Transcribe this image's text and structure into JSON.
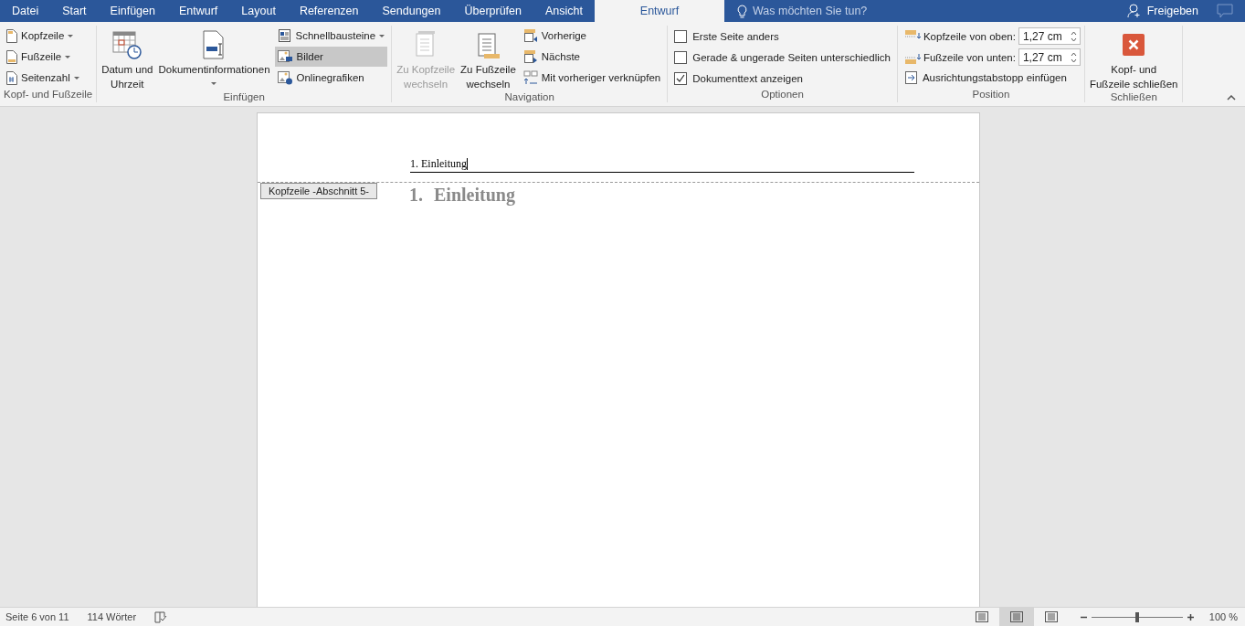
{
  "tabs": [
    {
      "label": "Datei",
      "selected": false
    },
    {
      "label": "Start",
      "selected": false
    },
    {
      "label": "Einfügen",
      "selected": false
    },
    {
      "label": "Entwurf",
      "selected": false
    },
    {
      "label": "Layout",
      "selected": false
    },
    {
      "label": "Referenzen",
      "selected": false
    },
    {
      "label": "Sendungen",
      "selected": false
    },
    {
      "label": "Überprüfen",
      "selected": false
    },
    {
      "label": "Ansicht",
      "selected": false
    },
    {
      "label": "Entwurf",
      "selected": true
    }
  ],
  "tell_me": {
    "placeholder": "Was möchten Sie tun?"
  },
  "share": {
    "label": "Freigeben"
  },
  "groups": [
    {
      "label": "Kopf- und Fußzeile",
      "columns": [
        [
          {
            "kind": "small",
            "label": "Kopfzeile",
            "dropdown": true,
            "disabled": false,
            "hovered": false
          },
          {
            "kind": "small",
            "label": "Fußzeile",
            "dropdown": true,
            "disabled": false,
            "hovered": false
          },
          {
            "kind": "small",
            "label": "Seitenzahl",
            "dropdown": true,
            "disabled": false,
            "hovered": false
          }
        ]
      ]
    },
    {
      "label": "Einfügen",
      "columns": [
        [
          {
            "kind": "large",
            "label": "Datum und\nUhrzeit",
            "dropdown": false,
            "disabled": false,
            "hovered": false
          }
        ],
        [
          {
            "kind": "large",
            "label": "Dokumentinformationen",
            "dropdown": true,
            "disabled": false,
            "hovered": false
          }
        ],
        [
          {
            "kind": "small",
            "label": "Schnellbausteine",
            "dropdown": true,
            "disabled": false,
            "hovered": false
          },
          {
            "kind": "small",
            "label": "Bilder",
            "dropdown": false,
            "disabled": false,
            "hovered": true
          },
          {
            "kind": "small",
            "label": "Onlinegrafiken",
            "dropdown": false,
            "disabled": false,
            "hovered": false
          }
        ]
      ]
    },
    {
      "label": "Navigation",
      "columns": [
        [
          {
            "kind": "large",
            "label": "Zu Kopfzeile\nwechseln",
            "dropdown": false,
            "disabled": true,
            "hovered": false
          }
        ],
        [
          {
            "kind": "large",
            "label": "Zu Fußzeile\nwechseln",
            "dropdown": false,
            "disabled": false,
            "hovered": false
          }
        ],
        [
          {
            "kind": "small",
            "label": "Vorherige",
            "dropdown": false,
            "disabled": false,
            "hovered": false
          },
          {
            "kind": "small",
            "label": "Nächste",
            "dropdown": false,
            "disabled": false,
            "hovered": false
          },
          {
            "kind": "small",
            "label": "Mit vorheriger verknüpfen",
            "dropdown": false,
            "disabled": false,
            "hovered": false
          }
        ]
      ]
    },
    {
      "label": "Optionen",
      "columns": [
        [
          {
            "kind": "check",
            "label": "Erste Seite anders",
            "checked": false
          },
          {
            "kind": "check",
            "label": "Gerade & ungerade Seiten unterschiedlich",
            "checked": false
          },
          {
            "kind": "check",
            "label": "Dokumenttext anzeigen",
            "checked": true
          }
        ]
      ]
    },
    {
      "label": "Position",
      "columns": [
        [
          {
            "kind": "spin",
            "label": "Kopfzeile von oben:",
            "value": "1,27 cm"
          },
          {
            "kind": "spin",
            "label": "Fußzeile von unten:",
            "value": "1,27 cm"
          },
          {
            "kind": "small",
            "label": "Ausrichtungstabstopp einfügen",
            "dropdown": false,
            "disabled": false,
            "hovered": false
          }
        ]
      ]
    },
    {
      "label": "Schließen",
      "columns": [
        [
          {
            "kind": "large",
            "label": "Kopf- und\nFußzeile schließen",
            "dropdown": false,
            "disabled": false,
            "hovered": false
          }
        ]
      ]
    }
  ],
  "document": {
    "header_text": "1. Einleitung",
    "header_tag": "Kopfzeile -Abschnitt 5-",
    "heading": {
      "number": "1.",
      "text": "Einleitung"
    }
  },
  "status_bar": {
    "page": "Seite 6 von 11",
    "words": "114 Wörter",
    "views": [
      {
        "selected": false
      },
      {
        "selected": true
      },
      {
        "selected": false
      }
    ],
    "zoom": {
      "level": 0.5,
      "reading": "100 %"
    }
  }
}
